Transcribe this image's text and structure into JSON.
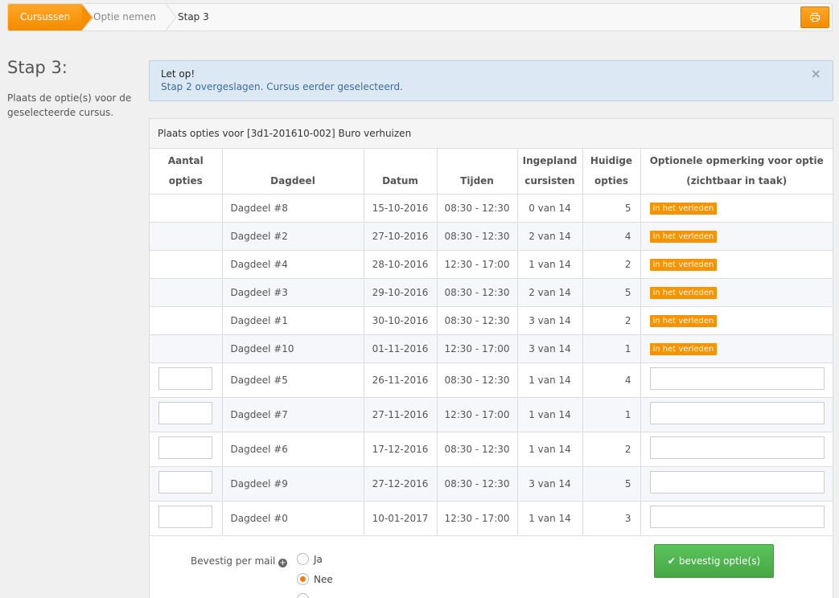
{
  "breadcrumb": {
    "items": [
      "Cursussen",
      "Optie nemen",
      "Stap 3"
    ]
  },
  "sidebar": {
    "title": "Stap 3:",
    "description": "Plaats de optie(s) voor de geselecteerde cursus."
  },
  "alert": {
    "title": "Let op!",
    "message": "Stap 2 overgeslagen. Cursus eerder geselecteerd.",
    "close": "×"
  },
  "panel": {
    "title": "Plaats opties voor [3d1-201610-002] Buro verhuizen",
    "columns": {
      "aantal_1": "Aantal",
      "aantal_2": "opties",
      "dagdeel": "Dagdeel",
      "datum": "Datum",
      "tijden": "Tijden",
      "ingepland_1": "Ingepland",
      "ingepland_2": "cursisten",
      "huidige_1": "Huidige",
      "huidige_2": "opties",
      "opmerking_1": "Optionele opmerking voor optie",
      "opmerking_2": "(zichtbaar in taak)"
    },
    "rows": [
      {
        "dagdeel": "Dagdeel #8",
        "datum": "15-10-2016",
        "tijden": "08:30 - 12:30",
        "ingepland": "0 van 14",
        "huidige": "5",
        "badge": "in het verleden"
      },
      {
        "dagdeel": "Dagdeel #2",
        "datum": "27-10-2016",
        "tijden": "08:30 - 12:30",
        "ingepland": "2 van 14",
        "huidige": "4",
        "badge": "in het verleden"
      },
      {
        "dagdeel": "Dagdeel #4",
        "datum": "28-10-2016",
        "tijden": "12:30 - 17:00",
        "ingepland": "1 van 14",
        "huidige": "2",
        "badge": "in het verleden"
      },
      {
        "dagdeel": "Dagdeel #3",
        "datum": "29-10-2016",
        "tijden": "08:30 - 12:30",
        "ingepland": "2 van 14",
        "huidige": "5",
        "badge": "in het verleden"
      },
      {
        "dagdeel": "Dagdeel #1",
        "datum": "30-10-2016",
        "tijden": "08:30 - 12:30",
        "ingepland": "3 van 14",
        "huidige": "2",
        "badge": "in het verleden"
      },
      {
        "dagdeel": "Dagdeel #10",
        "datum": "01-11-2016",
        "tijden": "12:30 - 17:00",
        "ingepland": "3 van 14",
        "huidige": "1",
        "badge": "in het verleden"
      },
      {
        "dagdeel": "Dagdeel #5",
        "datum": "26-11-2016",
        "tijden": "08:30 - 12:30",
        "ingepland": "1 van 14",
        "huidige": "4"
      },
      {
        "dagdeel": "Dagdeel #7",
        "datum": "27-11-2016",
        "tijden": "12:30 - 17:00",
        "ingepland": "1 van 14",
        "huidige": "1"
      },
      {
        "dagdeel": "Dagdeel #6",
        "datum": "17-12-2016",
        "tijden": "08:30 - 12:30",
        "ingepland": "1 van 14",
        "huidige": "2"
      },
      {
        "dagdeel": "Dagdeel #9",
        "datum": "27-12-2016",
        "tijden": "08:30 - 12:30",
        "ingepland": "3 van 14",
        "huidige": "5"
      },
      {
        "dagdeel": "Dagdeel #0",
        "datum": "10-01-2017",
        "tijden": "12:30 - 17:00",
        "ingepland": "1 van 14",
        "huidige": "3"
      }
    ]
  },
  "form": {
    "mail_label": "Bevestig per mail",
    "options": [
      {
        "label": "Ja",
        "checked": false
      },
      {
        "label": "Nee",
        "checked": true
      }
    ],
    "confirm_label": "bevestig optie(s)"
  },
  "colors": {
    "accent": "#f59300",
    "success": "#4cae4c",
    "alert_bg": "#dce9f5"
  }
}
